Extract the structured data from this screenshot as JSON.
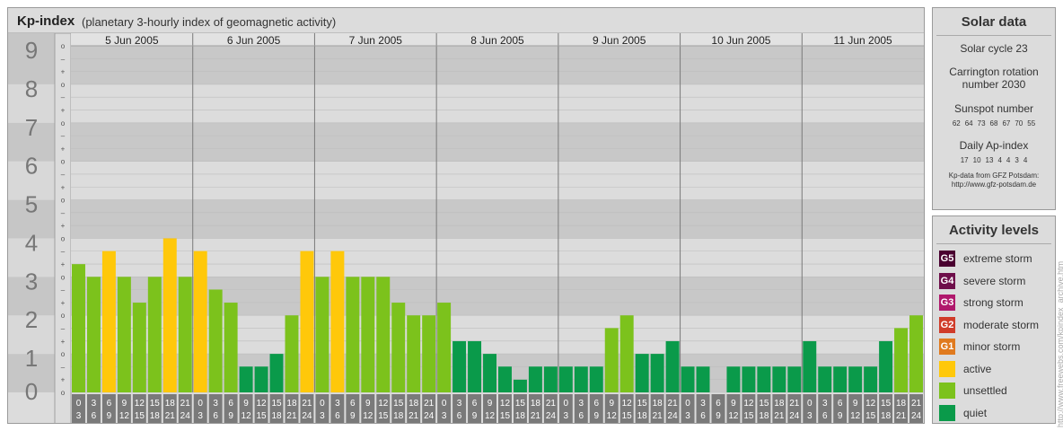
{
  "header": {
    "title": "Kp-index",
    "subtitle": "(planetary 3-hourly index of geomagnetic activity)"
  },
  "chart_data": {
    "type": "bar",
    "ylim": [
      0,
      9
    ],
    "y_ticks": [
      "0",
      "1",
      "2",
      "3",
      "4",
      "5",
      "6",
      "7",
      "8",
      "9"
    ],
    "minor_tick_labels": [
      "o",
      "+",
      "–"
    ],
    "days": [
      "5 Jun 2005",
      "6 Jun 2005",
      "7 Jun 2005",
      "8 Jun 2005",
      "9 Jun 2005",
      "10 Jun 2005",
      "11 Jun 2005"
    ],
    "hour_starts": [
      "0",
      "3",
      "6",
      "9",
      "12",
      "15",
      "18",
      "21"
    ],
    "hour_ends": [
      "3",
      "6",
      "9",
      "12",
      "15",
      "18",
      "21",
      "24"
    ],
    "values": [
      3.33,
      3.0,
      3.67,
      3.0,
      2.33,
      3.0,
      4.0,
      3.0,
      3.67,
      2.67,
      2.33,
      0.67,
      0.67,
      1.0,
      2.0,
      3.67,
      3.0,
      3.67,
      3.0,
      3.0,
      3.0,
      2.33,
      2.0,
      2.0,
      2.33,
      1.33,
      1.33,
      1.0,
      0.67,
      0.33,
      0.67,
      0.67,
      0.67,
      0.67,
      0.67,
      1.67,
      2.0,
      1.0,
      1.0,
      1.33,
      0.67,
      0.67,
      0.0,
      0.67,
      0.67,
      0.67,
      0.67,
      0.67,
      1.33,
      0.67,
      0.67,
      0.67,
      0.67,
      1.33,
      1.67,
      2.0
    ],
    "levels": [
      "unsettled",
      "unsettled",
      "active",
      "unsettled",
      "unsettled",
      "unsettled",
      "active",
      "unsettled",
      "active",
      "unsettled",
      "unsettled",
      "quiet",
      "quiet",
      "quiet",
      "unsettled",
      "active",
      "unsettled",
      "active",
      "unsettled",
      "unsettled",
      "unsettled",
      "unsettled",
      "unsettled",
      "unsettled",
      "unsettled",
      "quiet",
      "quiet",
      "quiet",
      "quiet",
      "quiet",
      "quiet",
      "quiet",
      "quiet",
      "quiet",
      "quiet",
      "unsettled",
      "unsettled",
      "quiet",
      "quiet",
      "quiet",
      "quiet",
      "quiet",
      "quiet",
      "quiet",
      "quiet",
      "quiet",
      "quiet",
      "quiet",
      "quiet",
      "quiet",
      "quiet",
      "quiet",
      "quiet",
      "quiet",
      "unsettled",
      "unsettled"
    ]
  },
  "colors": {
    "quiet": "#0a9a4a",
    "unsettled": "#7cc21c",
    "active": "#ffc80a",
    "minor": "#e07a1e",
    "moderate": "#d03c2a",
    "strong": "#b0186c",
    "severe": "#6e0e4a",
    "extreme": "#4a0030"
  },
  "solar": {
    "title": "Solar data",
    "cycle": "Solar cycle 23",
    "carrington_l1": "Carrington rotation",
    "carrington_l2": "number 2030",
    "sunspot_title": "Sunspot number",
    "sunspots": [
      "62",
      "64",
      "73",
      "68",
      "67",
      "70",
      "55"
    ],
    "ap_title": "Daily Ap-index",
    "ap": [
      "17",
      "10",
      "13",
      "4",
      "4",
      "3",
      "4"
    ],
    "credit_l1": "Kp-data from GFZ Potsdam:",
    "credit_l2": "http://www.gfz-potsdam.de"
  },
  "activity": {
    "title": "Activity levels",
    "items": [
      {
        "badge": "G5",
        "label": "extreme storm",
        "color": "#4a0030"
      },
      {
        "badge": "G4",
        "label": "severe storm",
        "color": "#6e0e4a"
      },
      {
        "badge": "G3",
        "label": "strong storm",
        "color": "#b0186c"
      },
      {
        "badge": "G2",
        "label": "moderate storm",
        "color": "#d03c2a"
      },
      {
        "badge": "G1",
        "label": "minor storm",
        "color": "#e07a1e"
      },
      {
        "badge": "",
        "label": "active",
        "color": "#ffc80a"
      },
      {
        "badge": "",
        "label": "unsettled",
        "color": "#7cc21c"
      },
      {
        "badge": "",
        "label": "quiet",
        "color": "#0a9a4a"
      }
    ]
  },
  "side_credit": "http://www.freewebs.com/kpindex_archive.htm"
}
